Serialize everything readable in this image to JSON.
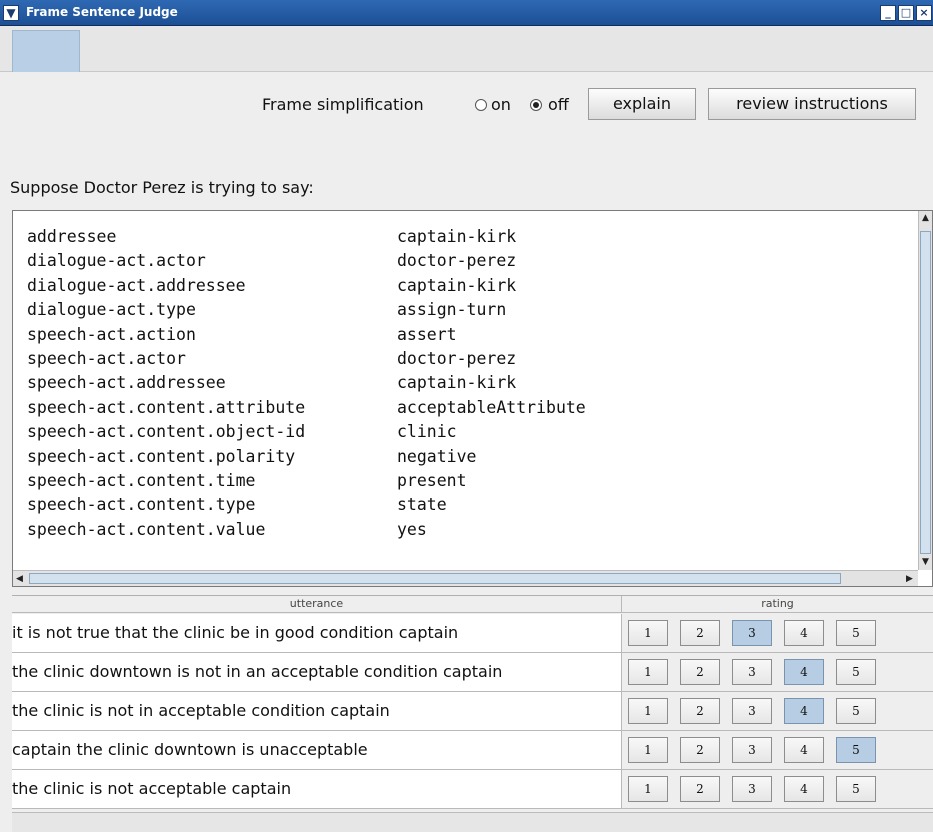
{
  "window": {
    "title": "Frame Sentence Judge"
  },
  "options": {
    "label": "Frame simplification",
    "on_label": "on",
    "off_label": "off",
    "selected": "off",
    "explain_label": "explain",
    "review_label": "review instructions"
  },
  "prompt": "Suppose Doctor Perez is trying to say:",
  "frame": [
    {
      "key": "addressee",
      "value": "captain-kirk"
    },
    {
      "key": "dialogue-act.actor",
      "value": "doctor-perez"
    },
    {
      "key": "dialogue-act.addressee",
      "value": "captain-kirk"
    },
    {
      "key": "dialogue-act.type",
      "value": "assign-turn"
    },
    {
      "key": "speech-act.action",
      "value": "assert"
    },
    {
      "key": "speech-act.actor",
      "value": "doctor-perez"
    },
    {
      "key": "speech-act.addressee",
      "value": "captain-kirk"
    },
    {
      "key": "speech-act.content.attribute",
      "value": "acceptableAttribute"
    },
    {
      "key": "speech-act.content.object-id",
      "value": "clinic"
    },
    {
      "key": "speech-act.content.polarity",
      "value": "negative"
    },
    {
      "key": "speech-act.content.time",
      "value": "present"
    },
    {
      "key": "speech-act.content.type",
      "value": "state"
    },
    {
      "key": "speech-act.content.value",
      "value": "yes"
    }
  ],
  "table": {
    "headers": {
      "utterance": "utterance",
      "rating": "rating"
    },
    "rating_options": [
      "1",
      "2",
      "3",
      "4",
      "5"
    ],
    "rows": [
      {
        "utterance": "it is not true that the clinic be in good condition captain",
        "selected_rating": 3
      },
      {
        "utterance": "the clinic downtown is not in an acceptable condition captain",
        "selected_rating": 4
      },
      {
        "utterance": "the clinic is not in acceptable condition captain",
        "selected_rating": 4
      },
      {
        "utterance": "captain the clinic downtown is unacceptable",
        "selected_rating": 5
      },
      {
        "utterance": "the clinic is not acceptable captain",
        "selected_rating": null
      }
    ]
  },
  "colors": {
    "titlebar": "#2f69b3",
    "selected_button": "#b7cde3"
  }
}
